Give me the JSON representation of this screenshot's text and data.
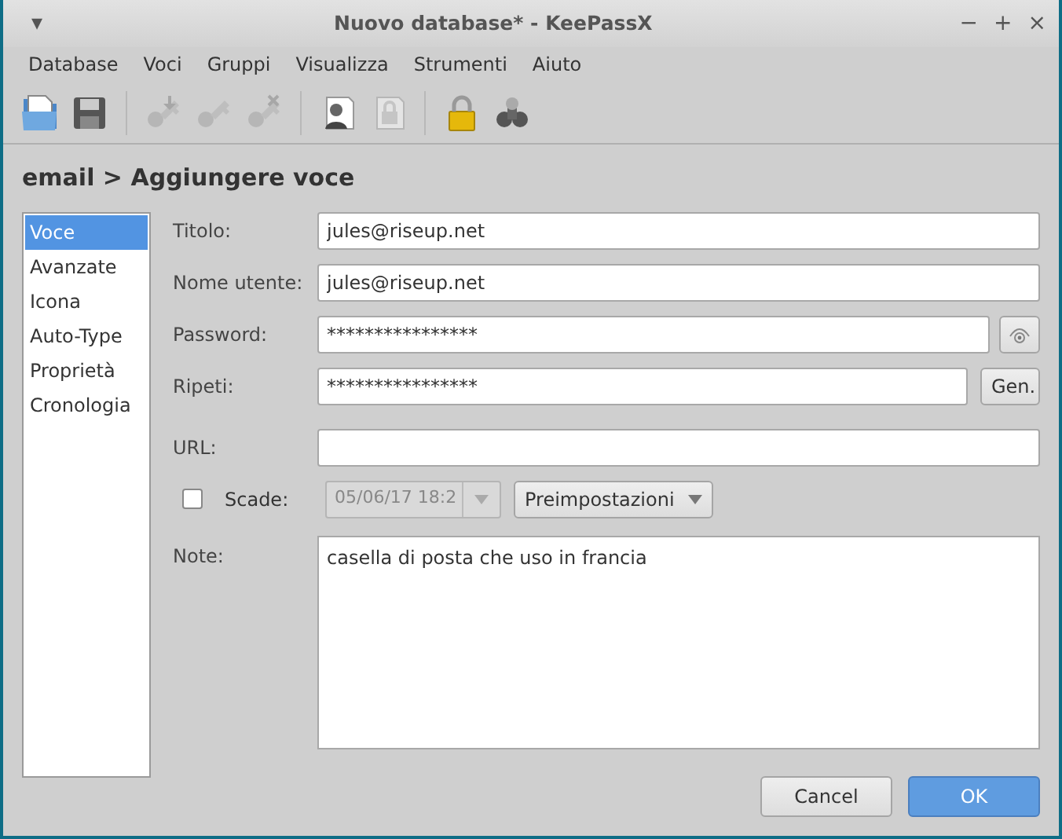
{
  "window": {
    "title": "Nuovo database* - KeePassX",
    "menu_glyph": "▾",
    "controls": [
      "−",
      "+",
      "×"
    ]
  },
  "menu": [
    "Database",
    "Voci",
    "Gruppi",
    "Visualizza",
    "Strumenti",
    "Aiuto"
  ],
  "toolbar": [
    {
      "kind": "open",
      "disabled": false
    },
    {
      "kind": "save",
      "disabled": false
    },
    {
      "kind": "separator"
    },
    {
      "kind": "key-add",
      "disabled": true
    },
    {
      "kind": "key-edit",
      "disabled": true
    },
    {
      "kind": "key-delete",
      "disabled": true
    },
    {
      "kind": "separator"
    },
    {
      "kind": "copy-user",
      "disabled": false
    },
    {
      "kind": "copy-password",
      "disabled": true
    },
    {
      "kind": "separator"
    },
    {
      "kind": "lock",
      "disabled": false
    },
    {
      "kind": "search",
      "disabled": false
    }
  ],
  "heading": "email > Aggiungere voce",
  "sidebar": {
    "items": [
      {
        "label": "Voce",
        "selected": true
      },
      {
        "label": "Avanzate",
        "selected": false
      },
      {
        "label": "Icona",
        "selected": false
      },
      {
        "label": "Auto-Type",
        "selected": false
      },
      {
        "label": "Proprietà",
        "selected": false
      },
      {
        "label": "Cronologia",
        "selected": false
      }
    ]
  },
  "form": [
    {
      "kind": "text",
      "label": "Titolo:",
      "value": "jules@riseup.net"
    },
    {
      "kind": "text",
      "label": "Nome utente:",
      "value": "jules@riseup.net"
    },
    {
      "kind": "reveal",
      "label": "Password:",
      "value": "****************"
    },
    {
      "kind": "generate",
      "label": "Ripeti:",
      "value": "****************",
      "button": "Gen."
    },
    {
      "kind": "text",
      "label": "URL:"
    },
    {
      "kind": "expiry",
      "label": "Scade:",
      "checked": false,
      "value": "05/06/17 18:2",
      "disabled": true,
      "preset": "Preimpostazioni"
    }
  ],
  "notes": {
    "label": "Note:",
    "value": "casella di posta che uso in francia"
  },
  "buttons": [
    {
      "label": "Cancel",
      "default": false
    },
    {
      "label": "OK",
      "default": true
    }
  ]
}
